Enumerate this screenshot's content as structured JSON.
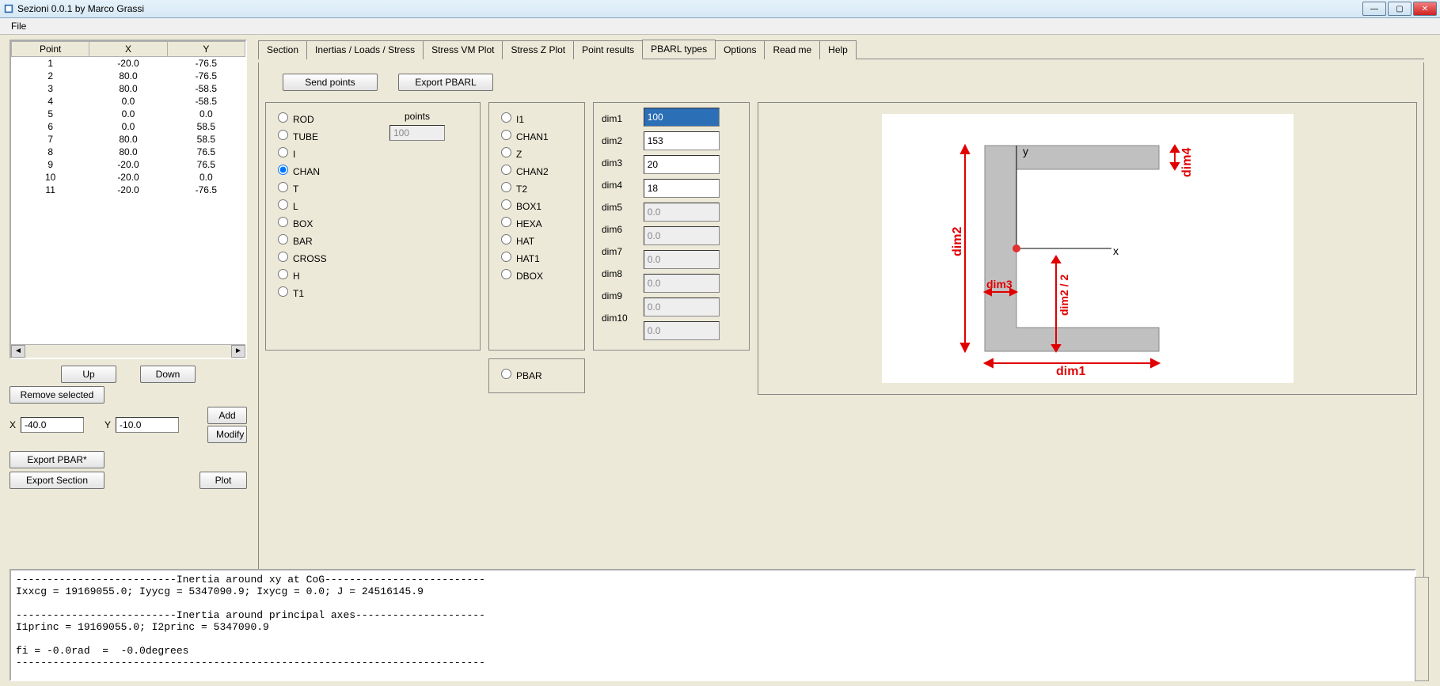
{
  "window": {
    "title": "Sezioni 0.0.1 by Marco Grassi"
  },
  "menu": {
    "file": "File"
  },
  "points_table": {
    "headers": [
      "Point",
      "X",
      "Y"
    ],
    "rows": [
      {
        "p": "1",
        "x": "-20.0",
        "y": "-76.5"
      },
      {
        "p": "2",
        "x": "80.0",
        "y": "-76.5"
      },
      {
        "p": "3",
        "x": "80.0",
        "y": "-58.5"
      },
      {
        "p": "4",
        "x": "0.0",
        "y": "-58.5"
      },
      {
        "p": "5",
        "x": "0.0",
        "y": "0.0"
      },
      {
        "p": "6",
        "x": "0.0",
        "y": "58.5"
      },
      {
        "p": "7",
        "x": "80.0",
        "y": "58.5"
      },
      {
        "p": "8",
        "x": "80.0",
        "y": "76.5"
      },
      {
        "p": "9",
        "x": "-20.0",
        "y": "76.5"
      },
      {
        "p": "10",
        "x": "-20.0",
        "y": "0.0"
      },
      {
        "p": "11",
        "x": "-20.0",
        "y": "-76.5"
      }
    ]
  },
  "left_controls": {
    "up": "Up",
    "down": "Down",
    "remove": "Remove selected",
    "xlabel": "X",
    "xval": "-40.0",
    "ylabel": "Y",
    "yval": "-10.0",
    "add": "Add",
    "modify": "Modify",
    "export_pbar": "Export PBAR*",
    "export_section": "Export Section",
    "plot": "Plot"
  },
  "tabs": [
    "Section",
    "Inertias / Loads / Stress",
    "Stress VM Plot",
    "Stress Z Plot",
    "Point results",
    "PBARL types",
    "Options",
    "Read me",
    "Help"
  ],
  "active_tab": 5,
  "pbarl": {
    "send": "Send points",
    "export": "Export PBARL",
    "points_label": "points",
    "points_value": "100",
    "radios_col1": [
      "ROD",
      "TUBE",
      "I",
      "CHAN",
      "T",
      "L",
      "BOX",
      "BAR",
      "CROSS",
      "H",
      "T1"
    ],
    "radios_col1_selected": "CHAN",
    "radios_col2": [
      "I1",
      "CHAN1",
      "Z",
      "CHAN2",
      "T2",
      "BOX1",
      "HEXA",
      "HAT",
      "HAT1",
      "DBOX"
    ],
    "pbar_radio": "PBAR",
    "dims_labels": [
      "dim1",
      "dim2",
      "dim3",
      "dim4",
      "dim5",
      "dim6",
      "dim7",
      "dim8",
      "dim9",
      "dim10"
    ],
    "dims_values": [
      "100",
      "153",
      "20",
      "18",
      "0.0",
      "0.0",
      "0.0",
      "0.0",
      "0.0",
      "0.0"
    ],
    "dims_enabled": [
      true,
      true,
      true,
      true,
      false,
      false,
      false,
      false,
      false,
      false
    ]
  },
  "diagram": {
    "labels": {
      "y": "y",
      "x": "x",
      "dim1": "dim1",
      "dim2": "dim2",
      "dim3": "dim3",
      "dim4": "dim4",
      "dim2_2": "dim2 / 2"
    }
  },
  "console_lines": [
    "--------------------------Inertia around xy at CoG--------------------------",
    "Ixxcg = 19169055.0; Iyycg = 5347090.9; Ixycg = 0.0; J = 24516145.9",
    "",
    "--------------------------Inertia around principal axes---------------------",
    "I1princ = 19169055.0; I2princ = 5347090.9",
    "",
    "fi = -0.0rad  =  -0.0degrees",
    "----------------------------------------------------------------------------"
  ]
}
